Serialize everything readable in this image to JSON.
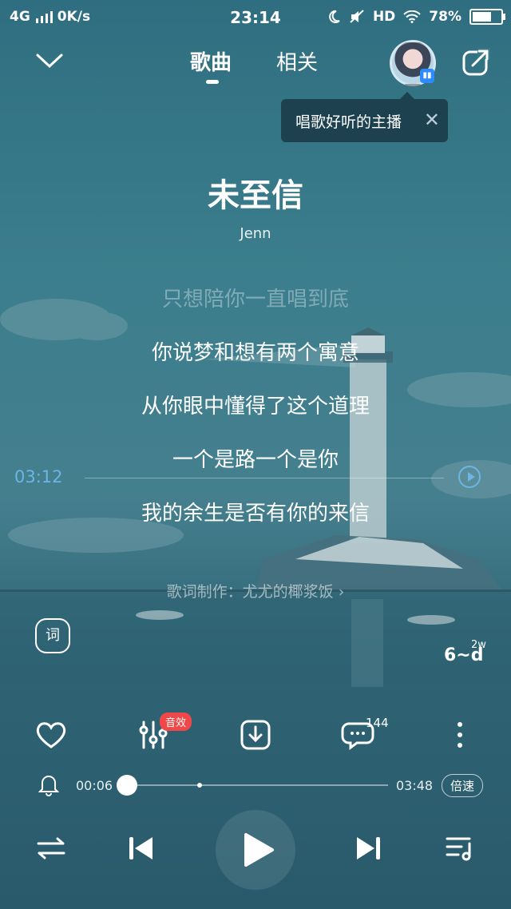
{
  "status_bar": {
    "network": "4G",
    "speed": "0K/s",
    "time": "23:14",
    "hd": "HD",
    "battery": "78%",
    "battery_level": 0.78
  },
  "header": {
    "tabs": [
      {
        "label": "歌曲",
        "active": true
      },
      {
        "label": "相关",
        "active": false
      }
    ],
    "tooltip": "唱歌好听的主播"
  },
  "song": {
    "title": "未至信",
    "artist": "Jenn"
  },
  "lyrics": [
    {
      "text": "只想陪你一直唱到底",
      "state": "past"
    },
    {
      "text": "你说梦和想有两个寓意",
      "state": "normal"
    },
    {
      "text": "从你眼中懂得了这个道理",
      "state": "normal"
    },
    {
      "text": "一个是路一个是你",
      "state": "normal"
    },
    {
      "text": "我的余生是否有你的来信",
      "state": "normal"
    }
  ],
  "lyric_seek_time": "03:12",
  "lyrics_credit": "歌词制作：尤尤的椰浆饭 ›",
  "lyric_button": "词",
  "quality_button": {
    "label": "6~d",
    "count": "2w"
  },
  "actions": {
    "effects_badge": "音效",
    "comment_count": "144"
  },
  "progress": {
    "current": "00:06",
    "total": "03:48",
    "fraction": 0.026,
    "speed_label": "倍速"
  },
  "colors": {
    "accent": "#6bb6e2",
    "badge": "#f04848",
    "tooltip_bg": "#1e4150"
  }
}
